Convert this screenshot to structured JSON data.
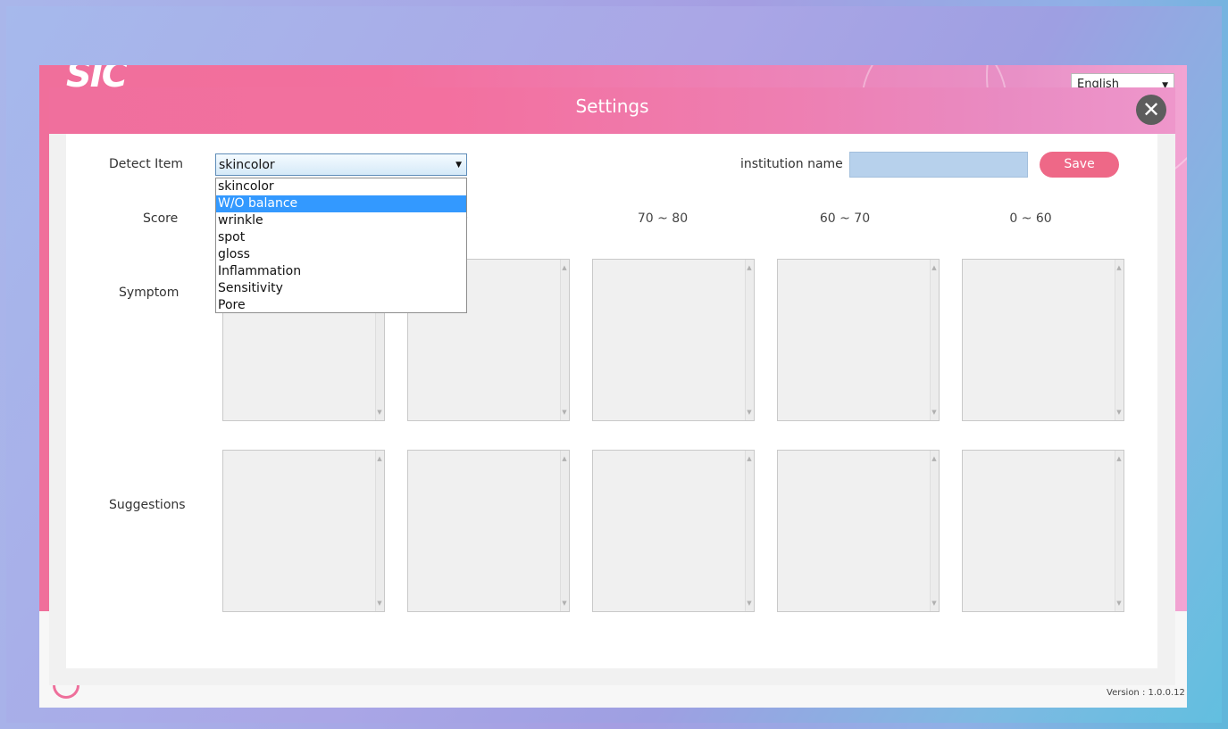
{
  "window": {
    "app_logo_text": "SIC",
    "language": "English",
    "version": "Version : 1.0.0.12"
  },
  "dialog": {
    "title": "Settings",
    "close_icon": "close-icon"
  },
  "form": {
    "detect_item_label": "Detect Item",
    "detect_item_value": "skincolor",
    "detect_item_options": [
      "skincolor",
      "W/O balance",
      "wrinkle",
      "spot",
      "gloss",
      "Inflammation",
      "Sensitivity",
      "Pore"
    ],
    "detect_item_highlighted": "W/O balance",
    "institution_label": "institution name",
    "institution_value": "",
    "save_label": "Save",
    "score_label": "Score",
    "symptom_label": "Symptom",
    "suggestions_label": "Suggestions",
    "score_ranges": [
      "",
      "~ 90",
      "70 ~ 80",
      "60 ~ 70",
      "0 ~ 60"
    ]
  },
  "colors": {
    "header_pink": "#f06f9d",
    "save_button": "#ee6887",
    "highlight": "#3399ff",
    "close_button": "#5d5d5d"
  }
}
